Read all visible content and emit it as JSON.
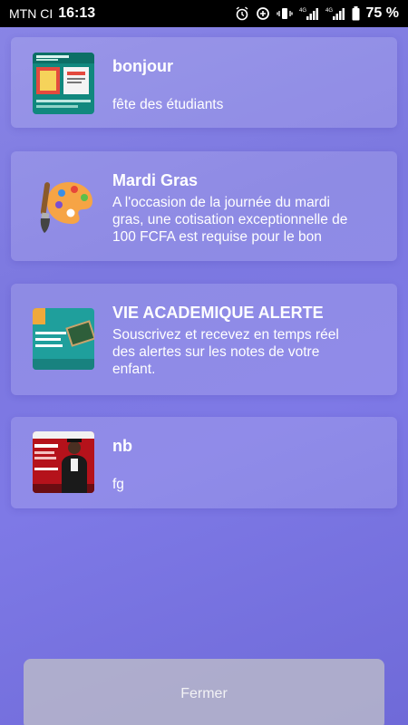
{
  "status_bar": {
    "carrier": "MTN CI",
    "time": "16:13",
    "network_label_1": "4G",
    "network_label_2": "4G",
    "battery_percent": "75 %"
  },
  "notifications": [
    {
      "title": "bonjour",
      "description": "fête des étudiants",
      "thumbnail": "flyer-teal-green-image"
    },
    {
      "title": "Mardi Gras",
      "description": "A l'occasion de la journée du mardi gras, une cotisation exceptionnelle de 100 FCFA est requise pour le bon",
      "thumbnail": "paint-palette-icon"
    },
    {
      "title": "VIE ACADEMIQUE ALERTE",
      "description": "Souscrivez et recevez en temps réel des alertes sur les notes de votre enfant.",
      "thumbnail": "teal-academic-banner-image"
    },
    {
      "title": "nb",
      "description": "fg",
      "thumbnail": "red-graduation-flyer-image"
    }
  ],
  "close_button": {
    "label": "Fermer"
  },
  "colors": {
    "background_start": "#8a86e6",
    "background_end": "#6f6ad8",
    "card_bg": "rgba(255,255,255,0.14)",
    "button_bg": "#bebec8"
  }
}
